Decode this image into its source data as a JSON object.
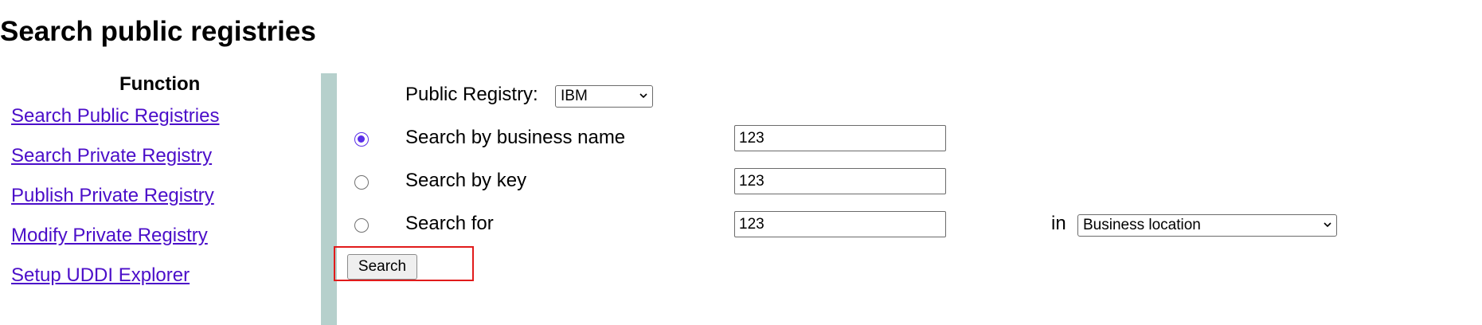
{
  "page": {
    "title": "Search public registries"
  },
  "sidebar": {
    "heading": "Function",
    "items": [
      {
        "label": "Search Public Registries"
      },
      {
        "label": "Search Private Registry"
      },
      {
        "label": "Publish Private Registry"
      },
      {
        "label": "Modify Private Registry"
      },
      {
        "label": "Setup UDDI Explorer"
      }
    ]
  },
  "form": {
    "registry": {
      "label": "Public Registry:",
      "selected": "IBM"
    },
    "options": [
      {
        "label": "Search by business name",
        "value": "123",
        "checked": true
      },
      {
        "label": "Search by key",
        "value": "123",
        "checked": false
      },
      {
        "label": "Search for",
        "value": "123",
        "checked": false
      }
    ],
    "in_label": "in",
    "in_select": {
      "selected": "Business location"
    },
    "search_button": "Search"
  },
  "colors": {
    "link": "#4b0ec9",
    "divider": "#b6d0cc",
    "highlight": "#e11b1b",
    "radio_accent": "#5a2ee8"
  },
  "icons": {
    "dropdown": "chevron-down-icon"
  }
}
